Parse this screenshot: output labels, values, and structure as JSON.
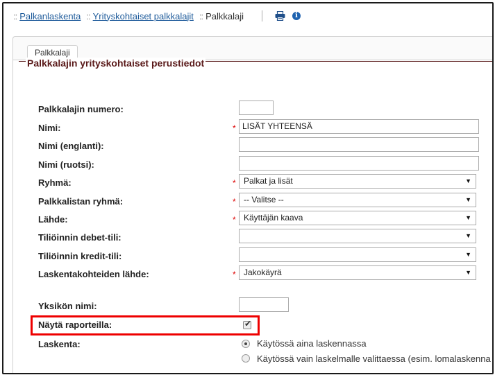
{
  "breadcrumbs": {
    "sep": "::",
    "items": [
      {
        "label": "Palkanlaskenta",
        "link": true
      },
      {
        "label": "Yrityskohtaiset palkkalajit",
        "link": true
      },
      {
        "label": "Palkkalaji",
        "link": false
      }
    ]
  },
  "toolbar": {
    "print_icon": "printer-icon",
    "info_icon": "info-icon"
  },
  "tab": {
    "label": "Palkkalaji"
  },
  "section": {
    "title": "Palkkalajin yrityskohtaiset perustiedot"
  },
  "form": {
    "numero": {
      "label": "Palkkalajin numero:",
      "value": ""
    },
    "nimi": {
      "label": "Nimi:",
      "value": "LISÄT YHTEENSÄ"
    },
    "nimi_en": {
      "label": "Nimi (englanti):",
      "value": ""
    },
    "nimi_sv": {
      "label": "Nimi (ruotsi):",
      "value": ""
    },
    "ryhma": {
      "label": "Ryhmä:",
      "value": "Palkat ja lisät"
    },
    "palkkalistan_ryhma": {
      "label": "Palkkalistan ryhmä:",
      "value": "-- Valitse --"
    },
    "lahde": {
      "label": "Lähde:",
      "value": "Käyttäjän kaava"
    },
    "debet": {
      "label": "Tiliöinnin debet-tili:",
      "value": ""
    },
    "kredit": {
      "label": "Tiliöinnin kredit-tili:",
      "value": ""
    },
    "laskentakohteiden_lahde": {
      "label": "Laskentakohteiden lähde:",
      "value": "Jakokäyrä"
    },
    "yksikon_nimi": {
      "label": "Yksikön nimi:",
      "value": ""
    },
    "nayta_raporteilla": {
      "label": "Näytä raporteilla:",
      "checked": true
    },
    "laskenta": {
      "label": "Laskenta:",
      "options": [
        {
          "label": "Käytössä aina laskennassa",
          "selected": true
        },
        {
          "label": "Käytössä vain laskelmalle valittaessa (esim. lomalaskenna",
          "selected": false
        }
      ]
    }
  },
  "required_marker": "*",
  "select_arrow": "▼",
  "colors": {
    "link": "#1d5a9a",
    "section_title": "#5a1a1a",
    "required": "#dd0000",
    "highlight": "#ee0000",
    "info": "#1f63b0"
  }
}
